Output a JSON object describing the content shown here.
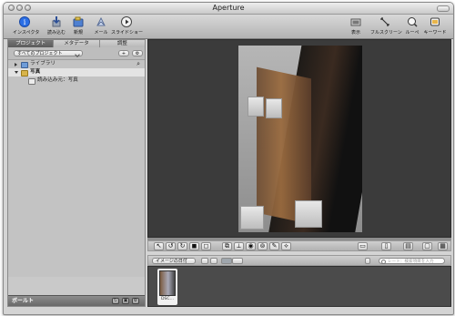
{
  "window": {
    "title": "Aperture"
  },
  "toolbar": {
    "items": [
      {
        "label": "インスペクタ",
        "icon": "info-icon"
      },
      {
        "label": "読み込む",
        "icon": "import-icon"
      },
      {
        "label": "新規",
        "icon": "new-folder-icon"
      },
      {
        "label": "メール",
        "icon": "mail-icon"
      },
      {
        "label": "スライドショー",
        "icon": "slideshow-icon"
      },
      {
        "label": "表示",
        "icon": "view-icon"
      },
      {
        "label": "フルスクリーン",
        "icon": "fullscreen-icon"
      },
      {
        "label": "ルーペ",
        "icon": "loupe-icon"
      },
      {
        "label": "キーワード",
        "icon": "keywords-icon"
      }
    ]
  },
  "sidebar": {
    "tabs": [
      "プロジェクト",
      "メタデータ",
      "調整"
    ],
    "filter": {
      "selected": "すべてのプロジェクト"
    },
    "items": [
      {
        "label": "ライブラリ"
      },
      {
        "label": "写真"
      },
      {
        "label": "読み込み元：写真"
      }
    ],
    "bottom": {
      "label": "ボールト"
    }
  },
  "browser": {
    "sort": {
      "selected": "イメージの日付"
    },
    "search_placeholder": "レート：検索項目を入力",
    "thumbnail_label": "DSC..."
  },
  "colors": {
    "viewer_bg": "#3b3b3b",
    "selection_bg": "#e3e3e3"
  }
}
